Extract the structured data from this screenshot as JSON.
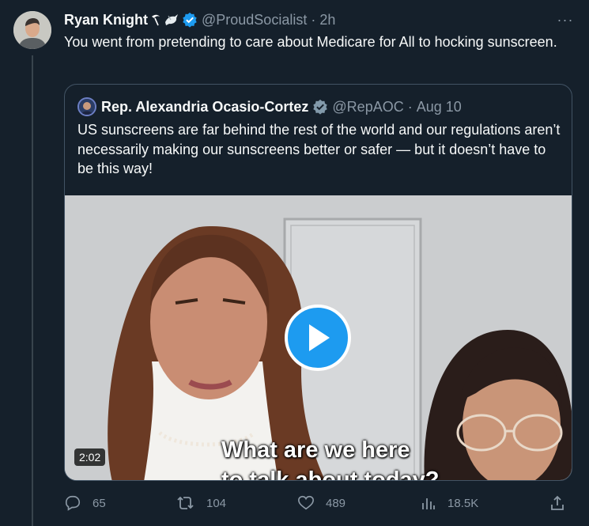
{
  "tweet": {
    "author_name": "Ryan Knight",
    "handle": "@ProudSocialist",
    "separator": "·",
    "time": "2h",
    "text": "You went from pretending to care about Medicare for All to hocking sunscreen.",
    "more_label": "···"
  },
  "quote": {
    "author_name": "Rep. Alexandria Ocasio-Cortez",
    "handle": "@RepAOC",
    "separator": "·",
    "date": "Aug 10",
    "text": "US sunscreens are far behind the rest of the world and our regulations aren’t necessarily making our sunscreens better or safer — but it doesn’t have to be this way!",
    "video": {
      "duration": "2:02",
      "caption_line1": "What are we here",
      "caption_line2": "to talk about today?"
    }
  },
  "actions": {
    "replies": "65",
    "retweets": "104",
    "likes": "489",
    "views": "18.5K"
  },
  "colors": {
    "background": "#15202b",
    "text": "#f7f9f9",
    "muted": "#8b98a5",
    "verified": "#1d9bf0",
    "border": "#425364"
  },
  "icons": [
    "rose-emoji-icon",
    "dove-emoji-icon",
    "verified-badge-icon",
    "more-icon",
    "play-icon",
    "reply-icon",
    "retweet-icon",
    "like-icon",
    "views-icon",
    "share-icon"
  ]
}
